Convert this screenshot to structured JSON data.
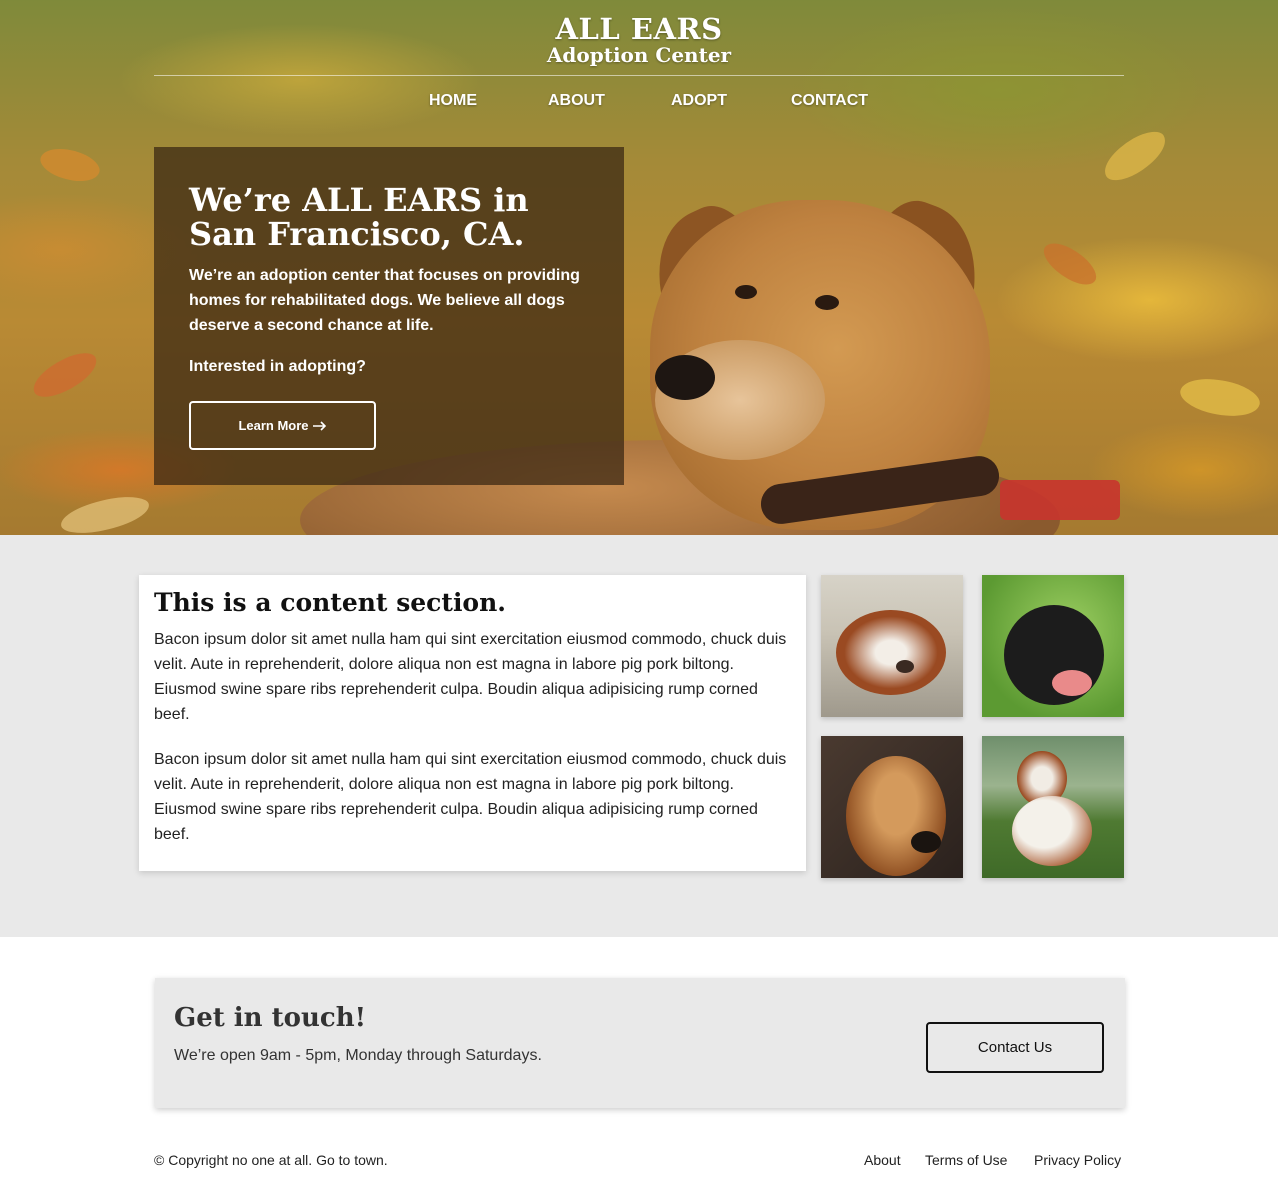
{
  "brand": {
    "title": "ALL EARS",
    "subtitle": "Adoption Center"
  },
  "nav": {
    "items": [
      {
        "label": "HOME"
      },
      {
        "label": "ABOUT"
      },
      {
        "label": "ADOPT"
      },
      {
        "label": "CONTACT"
      }
    ]
  },
  "hero": {
    "title_line1": "We’re ALL EARS in",
    "title_line2": "San Francisco, CA.",
    "description": "We’re an adoption center that focuses on providing homes for rehabilitated dogs. We believe all dogs deserve a second chance at life.",
    "question": "Interested in adopting?",
    "button_label": "Learn More",
    "button_icon": "arrow-right-icon"
  },
  "content": {
    "title": "This is a content section.",
    "paragraphs": [
      "Bacon ipsum dolor sit amet nulla ham qui sint exercitation eiusmod commodo, chuck duis velit. Aute in reprehenderit, dolore aliqua non est magna in labore pig pork biltong. Eiusmod swine spare ribs reprehenderit culpa. Boudin aliqua adipisicing rump corned beef.",
      "Bacon ipsum dolor sit amet nulla ham qui sint exercitation eiusmod commodo, chuck duis velit. Aute in reprehenderit, dolore aliqua non est magna in labore pig pork biltong. Eiusmod swine spare ribs reprehenderit culpa. Boudin aliqua adipisicing rump corned beef."
    ]
  },
  "contact": {
    "title": "Get in touch!",
    "text": "We’re open 9am - 5pm, Monday through Saturdays.",
    "button_label": "Contact Us"
  },
  "footer": {
    "copyright": "© Copyright no one at all. Go to town.",
    "links": [
      {
        "label": "About"
      },
      {
        "label": "Terms of Use"
      },
      {
        "label": "Privacy Policy"
      }
    ]
  },
  "colors": {
    "hero_overlay": "#37260f",
    "content_bg": "#e9e9e9",
    "text": "#222222"
  }
}
